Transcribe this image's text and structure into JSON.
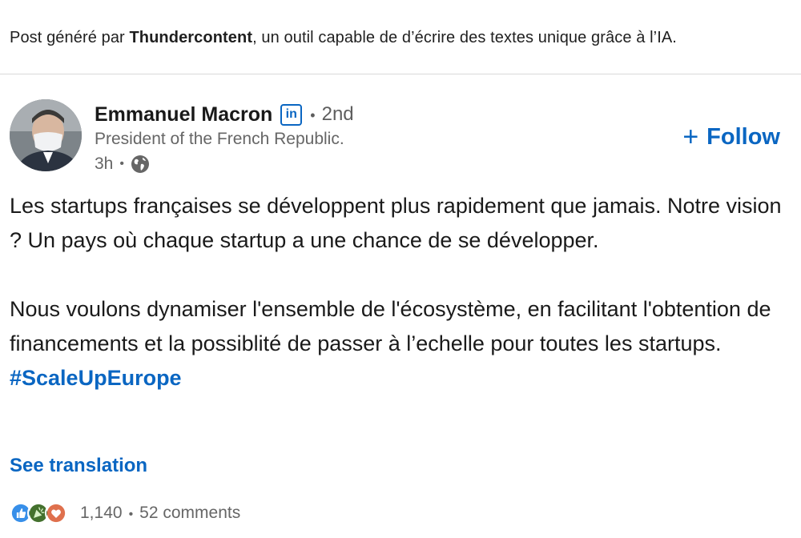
{
  "banner": {
    "prefix": "Post généré par ",
    "brand": "Thundercontent",
    "suffix": ", un outil capable de d’écrire des textes unique grâce à l’IA."
  },
  "author": {
    "name": "Emmanuel Macron",
    "badge": "in",
    "degree": "2nd",
    "headline": "President of the French Republic.",
    "time": "3h"
  },
  "follow_label": "Follow",
  "post": {
    "paragraph1": "Les startups françaises se développent plus rapidement que jamais. Notre vision ? Un pays où chaque startup a une chance de se développer.",
    "paragraph2": "Nous voulons dynamiser l'ensemble de l'écosystème, en facilitant l'obtention de financements et la possiblité de passer à l’echelle pour toutes les startups.",
    "hashtag": "#ScaleUpEurope"
  },
  "see_translation": "See translation",
  "social": {
    "reactions": [
      "like-icon",
      "celebrate-icon",
      "love-icon"
    ],
    "reaction_count": "1,140",
    "comments": "52 comments"
  },
  "colors": {
    "link": "#0a66c2",
    "secondary_text": "#666666",
    "divider": "#d9d9d9"
  }
}
